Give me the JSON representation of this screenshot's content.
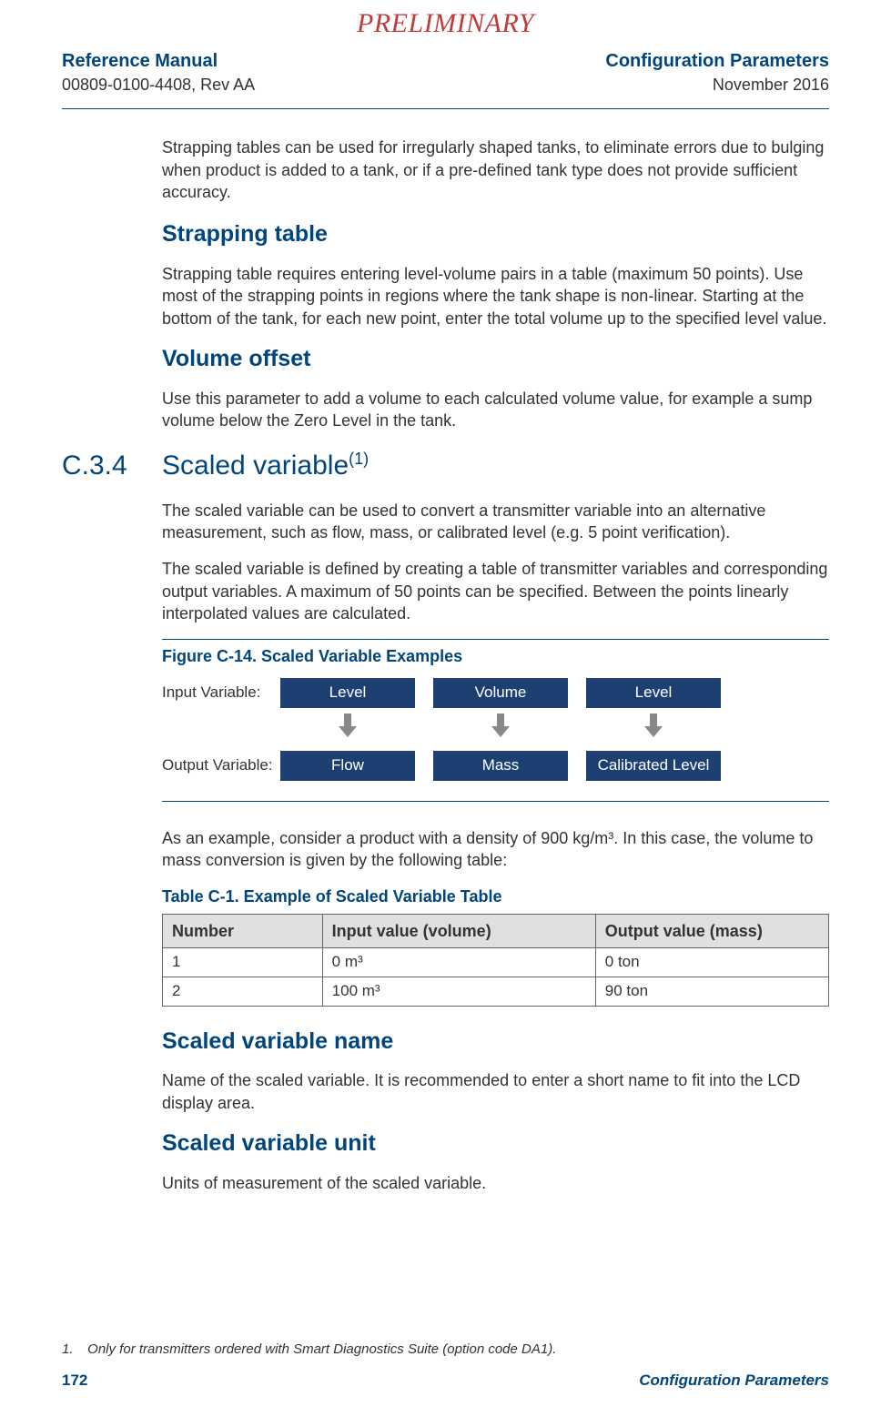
{
  "watermark": "PRELIMINARY",
  "header": {
    "left": {
      "title": "Reference Manual",
      "doc_id": "00809-0100-4408, Rev AA"
    },
    "right": {
      "section": "Configuration Parameters",
      "date": "November 2016"
    }
  },
  "intro_paragraph": "Strapping tables can be used for irregularly shaped tanks, to eliminate errors due to bulging when product is added to a tank, or if a pre-defined tank type does not provide sufficient accuracy.",
  "strapping_table": {
    "heading": "Strapping table",
    "paragraph": "Strapping table requires entering level-volume pairs in a table (maximum 50 points). Use most of the strapping points in regions where the tank shape is non-linear. Starting at the bottom of the tank, for each new point, enter the total volume up to the specified level value."
  },
  "volume_offset": {
    "heading": "Volume offset",
    "paragraph": "Use this parameter to add a volume to each calculated volume value, for example a sump volume below the Zero Level in the tank."
  },
  "scaled_variable": {
    "section_num": "C.3.4",
    "heading": "Scaled variable",
    "footnote_ref": "(1)",
    "p1": "The scaled variable can be used to convert a transmitter variable into an alternative measurement, such as flow, mass, or calibrated level (e.g. 5 point verification).",
    "p2": "The scaled variable is defined by creating a table of transmitter variables and corresponding output variables. A maximum of 50 points can be specified. Between the points linearly interpolated values are calculated."
  },
  "figure": {
    "title": "Figure C-14. Scaled Variable Examples",
    "input_label": "Input Variable:",
    "output_label": "Output Variable:",
    "inputs": [
      "Level",
      "Volume",
      "Level"
    ],
    "outputs": [
      "Flow",
      "Mass",
      "Calibrated Level"
    ]
  },
  "example_intro": "As an example, consider a product with a density of 900 kg/m³. In this case, the volume to mass conversion is given by the following table:",
  "table": {
    "title": "Table C-1.  Example of Scaled Variable Table",
    "headers": [
      "Number",
      "Input value (volume)",
      "Output value (mass)"
    ],
    "rows": [
      {
        "num": "1",
        "input": "0 m³",
        "output": "0 ton"
      },
      {
        "num": "2",
        "input": "100 m³",
        "output": "90 ton"
      }
    ]
  },
  "sv_name": {
    "heading": "Scaled variable name",
    "paragraph": "Name of the scaled variable. It is recommended to enter a short name to fit into the LCD display area."
  },
  "sv_unit": {
    "heading": "Scaled variable unit",
    "paragraph": "Units of measurement of the scaled variable."
  },
  "footnote": {
    "num": "1.",
    "text": "Only for transmitters ordered with Smart Diagnostics Suite (option code DA1)."
  },
  "footer": {
    "page": "172",
    "section": "Configuration Parameters"
  }
}
